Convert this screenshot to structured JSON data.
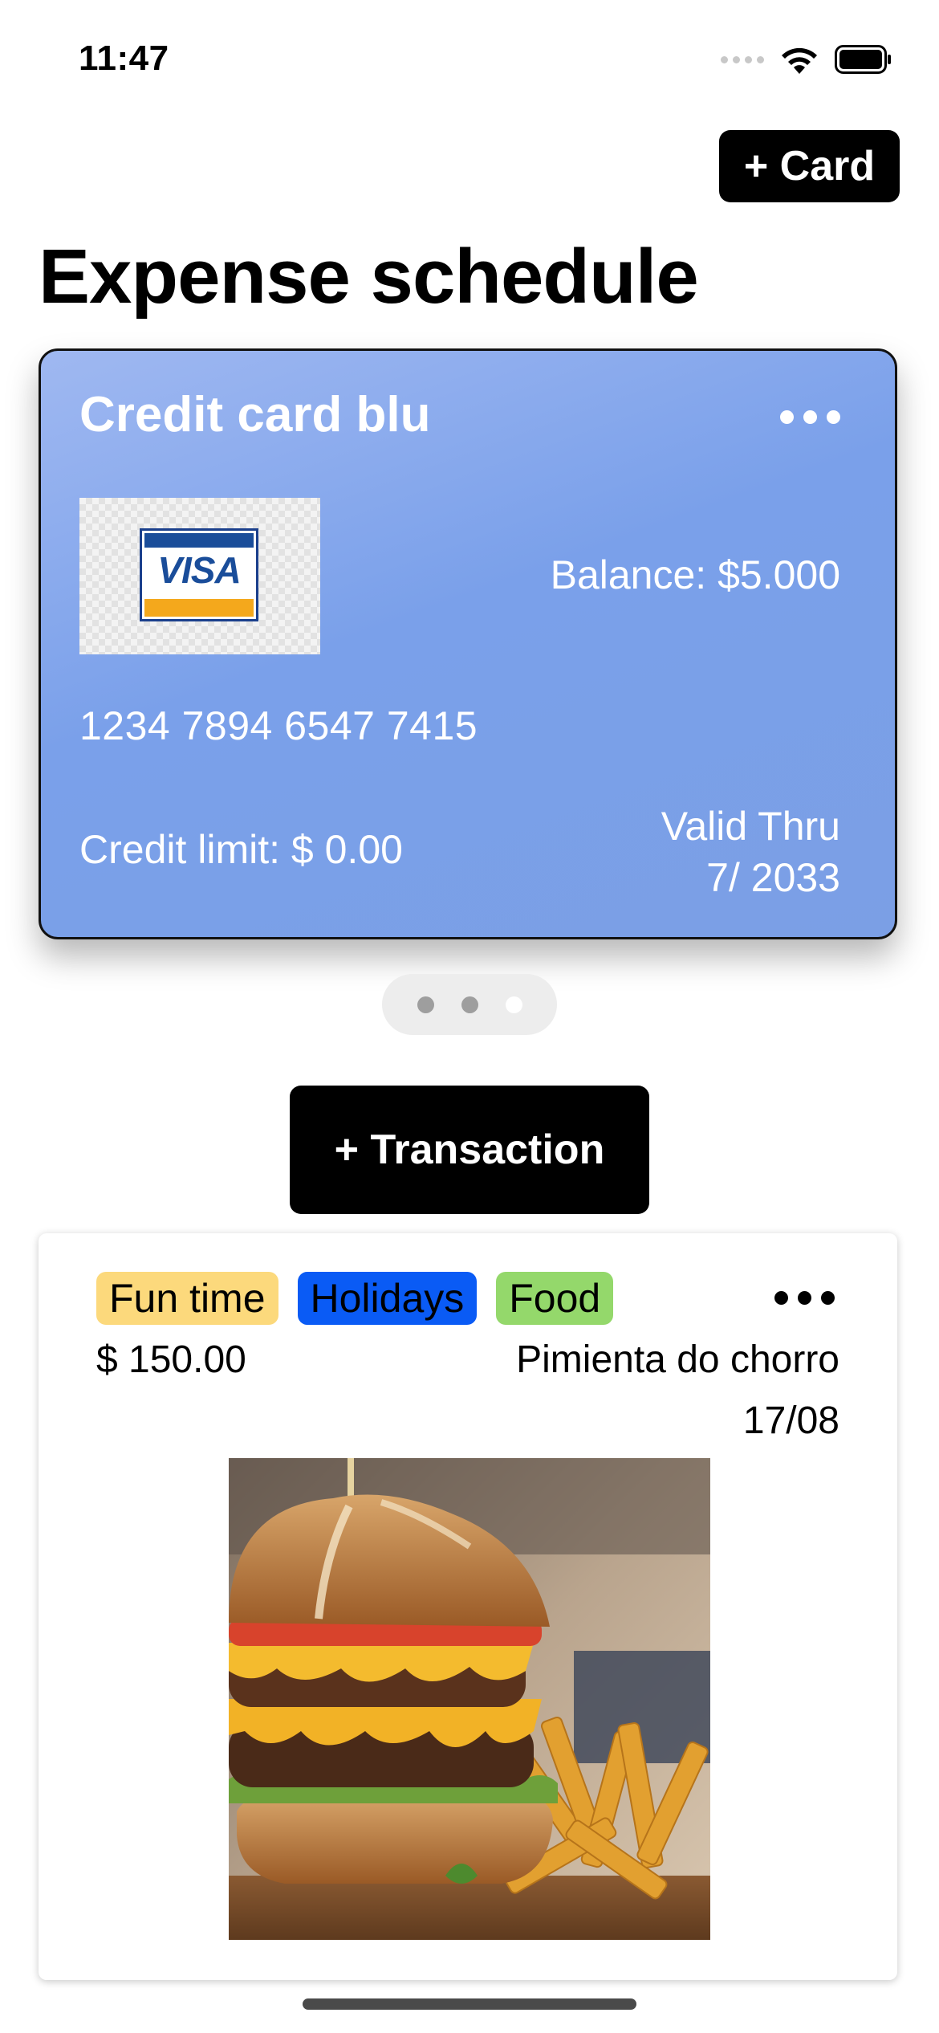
{
  "status_bar": {
    "time": "11:47"
  },
  "header": {
    "add_card_label": "+ Card",
    "title": "Expense schedule"
  },
  "card": {
    "name": "Credit card blu",
    "brand": "VISA",
    "balance": "Balance: $5.000",
    "number": "1234 7894 6547 7415",
    "credit_limit": "Credit limit: $ 0.00",
    "valid_label": "Valid Thru",
    "valid_date": "7/ 2033",
    "gradient_colors": [
      "#9fb8f1",
      "#7aa0ea",
      "#7b9fe5"
    ]
  },
  "pager": {
    "pages": 3,
    "active_index": 2
  },
  "actions": {
    "add_transaction_label": "+ Transaction"
  },
  "transaction": {
    "tags": [
      {
        "label": "Fun time",
        "color": "#fcd97c"
      },
      {
        "label": "Holidays",
        "color": "#0a5bf5"
      },
      {
        "label": "Food",
        "color": "#94d86b"
      }
    ],
    "amount": "$ 150.00",
    "merchant": "Pimienta do chorro",
    "date": "17/08",
    "photo_icon": "burger-fries-photo"
  }
}
